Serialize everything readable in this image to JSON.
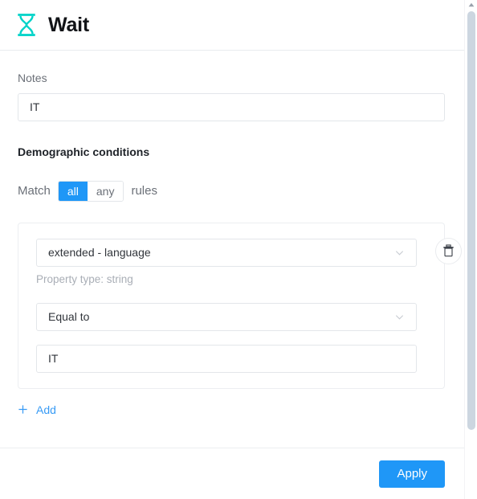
{
  "header": {
    "title": "Wait",
    "icon": "hourglass-icon",
    "icon_color": "#00d3c8"
  },
  "notes": {
    "label": "Notes",
    "value": "IT",
    "placeholder": ""
  },
  "conditions": {
    "heading": "Demographic conditions",
    "match_prefix": "Match",
    "match_suffix": "rules",
    "toggle_options": [
      "all",
      "any"
    ],
    "toggle_selected": "all",
    "accent_color": "#1f97f7",
    "rules": [
      {
        "property": "extended - language",
        "property_helper": "Property type: string",
        "operator": "Equal to",
        "value": "IT",
        "value_placeholder": "",
        "delete_icon": "trash-icon"
      }
    ],
    "add_label": "Add",
    "add_icon": "plus-icon"
  },
  "footer": {
    "apply_label": "Apply"
  },
  "scrollbar": {
    "up_icon": "caret-up-icon",
    "down_icon": "caret-down-icon",
    "thumb_color": "#ccd6e0"
  }
}
